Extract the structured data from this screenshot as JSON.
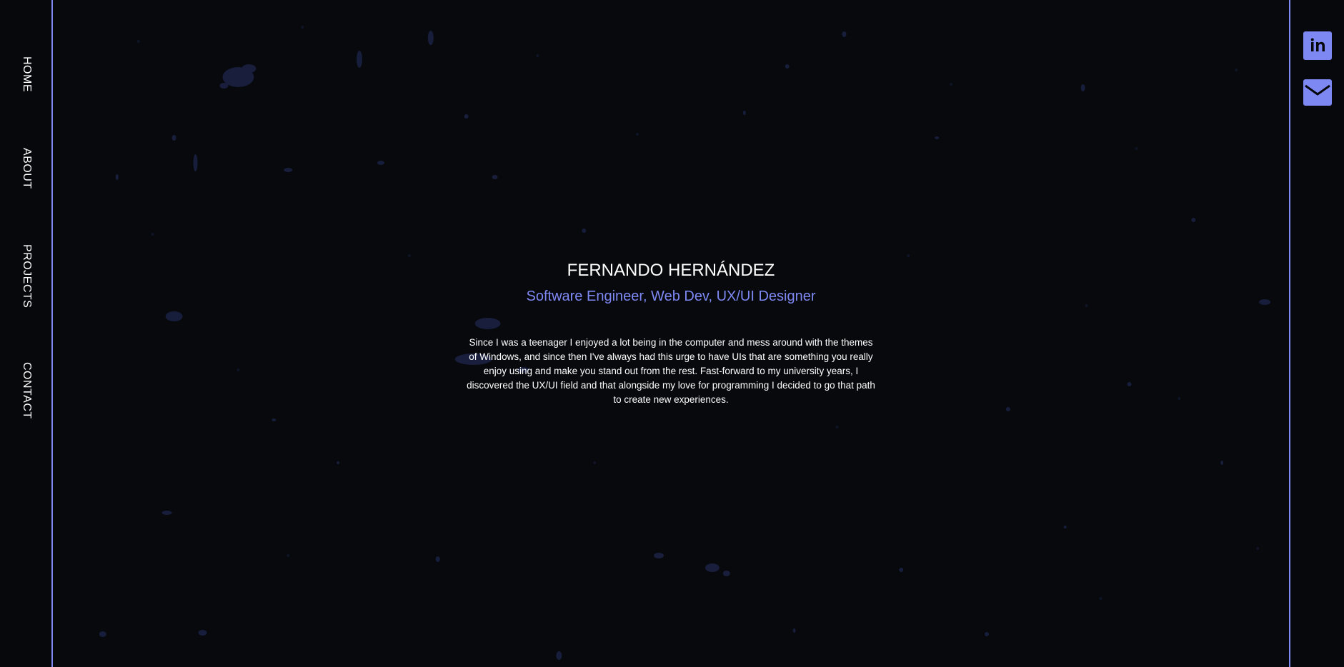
{
  "nav": {
    "items": [
      {
        "label": "HOME"
      },
      {
        "label": "ABOUT"
      },
      {
        "label": "PROJECTS"
      },
      {
        "label": "CONTACT"
      }
    ]
  },
  "hero": {
    "name": "FERNANDO HERNÁNDEZ",
    "subtitle": "Software Engineer, Web Dev, UX/UI Designer",
    "bio": "Since I was a teenager I enjoyed a lot being in the computer and mess around with the themes of Windows, and since then I've always had this urge to have UIs that are something you really enjoy using and make you stand out from the rest. Fast-forward to my university years, I discovered the UX/UI field and that alongside my love for programming I decided to go that path to create new experiences."
  },
  "social": {
    "links": [
      {
        "icon": "linkedin-icon"
      },
      {
        "icon": "mail-icon"
      }
    ]
  },
  "colors": {
    "accent": "#7e88f2",
    "background": "#07090d",
    "text": "#ffffff"
  }
}
